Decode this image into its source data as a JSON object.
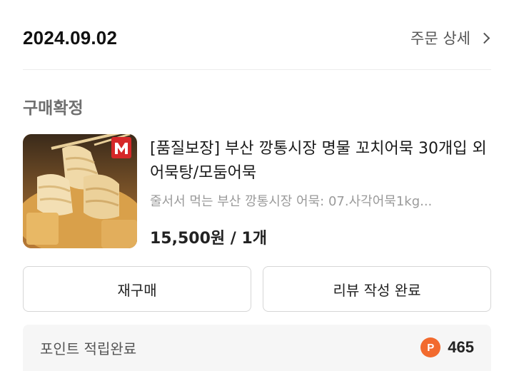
{
  "order": {
    "date": "2024.09.02",
    "detail_link": "주문 상세"
  },
  "status": "구매확정",
  "product": {
    "title": "[품질보장] 부산 깡통시장 명물 꼬치어묵 30개입 외 어묵탕/모둠어묵",
    "option": "줄서서 먹는 부산 깡통시장 어묵: 07.사각어묵1kg...",
    "price": "15,500원 / 1개",
    "image_alt": "fishcake-skewers",
    "brand_badge_color": "#d62828"
  },
  "buttons": {
    "repurchase": "재구매",
    "review": "리뷰 작성 완료"
  },
  "points": {
    "label": "포인트 적립완료",
    "icon_letter": "P",
    "value": "465",
    "icon_color": "#f26a2e"
  }
}
